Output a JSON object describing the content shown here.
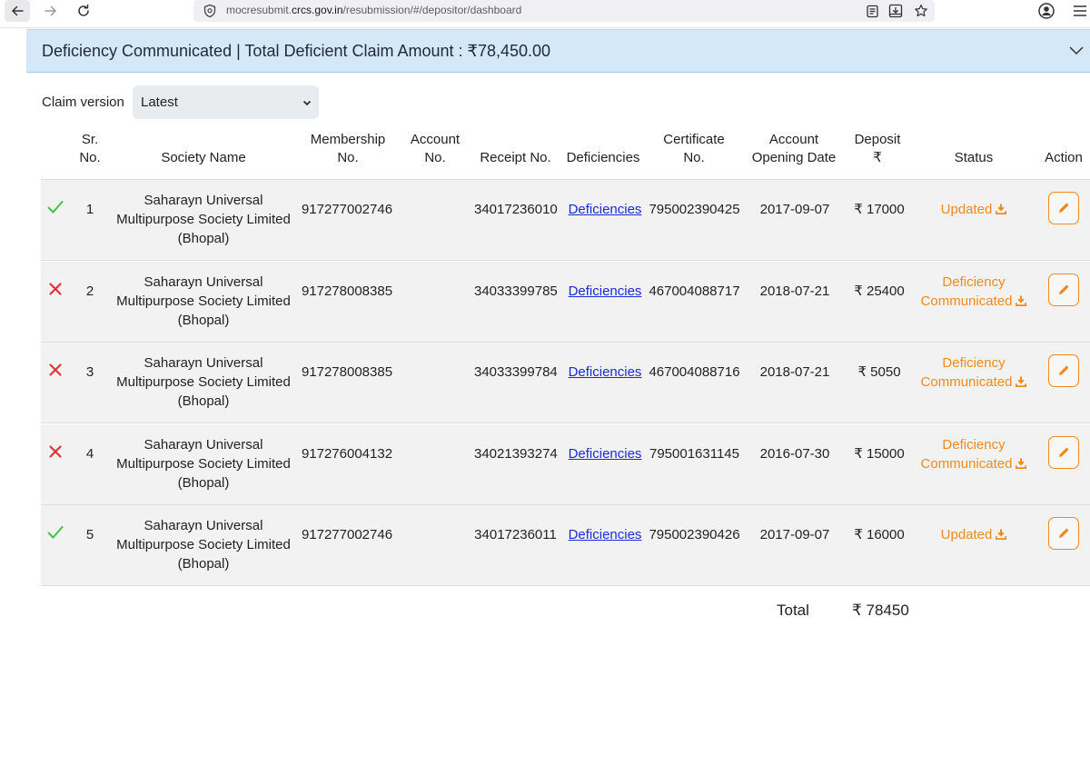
{
  "browser": {
    "url_prefix": "mocresubmit.",
    "url_domain": "crcs.gov.in",
    "url_path": "/resubmission/#/depositor/dashboard"
  },
  "accordion": {
    "title": "Deficiency Communicated | Total Deficient Claim Amount : ₹78,450.00"
  },
  "claim_version": {
    "label": "Claim version",
    "selected": "Latest"
  },
  "table": {
    "headers": {
      "sr_1": "Sr.",
      "sr_2": "No.",
      "society": "Society Name",
      "membership_1": "Membership",
      "membership_2": "No.",
      "account_1": "Account",
      "account_2": "No.",
      "receipt": "Receipt No.",
      "deficiencies": "Deficiencies",
      "certificate_1": "Certificate",
      "certificate_2": "No.",
      "opening_1": "Account",
      "opening_2": "Opening Date",
      "deposit_1": "Deposit",
      "deposit_2": "₹",
      "status": "Status",
      "action": "Action"
    },
    "rows": [
      {
        "mark": "check-icon",
        "sr": "1",
        "society_1": "Saharayn Universal",
        "society_2": "Multipurpose Society Limited",
        "society_3": "(Bhopal)",
        "membership": "917277002746",
        "account": "",
        "receipt": "34017236010",
        "deficiencies": "Deficiencies",
        "certificate": "795002390425",
        "opening_date": "2017-09-07",
        "deposit": "₹ 17000",
        "status_1": "Updated",
        "status_2": ""
      },
      {
        "mark": "cross-icon",
        "sr": "2",
        "society_1": "Saharayn Universal",
        "society_2": "Multipurpose Society Limited",
        "society_3": "(Bhopal)",
        "membership": "917278008385",
        "account": "",
        "receipt": "34033399785",
        "deficiencies": "Deficiencies",
        "certificate": "467004088717",
        "opening_date": "2018-07-21",
        "deposit": "₹ 25400",
        "status_1": "Deficiency",
        "status_2": "Communicated"
      },
      {
        "mark": "cross-icon",
        "sr": "3",
        "society_1": "Saharayn Universal",
        "society_2": "Multipurpose Society Limited",
        "society_3": "(Bhopal)",
        "membership": "917278008385",
        "account": "",
        "receipt": "34033399784",
        "deficiencies": "Deficiencies",
        "certificate": "467004088716",
        "opening_date": "2018-07-21",
        "deposit": "₹ 5050",
        "status_1": "Deficiency",
        "status_2": "Communicated"
      },
      {
        "mark": "cross-icon",
        "sr": "4",
        "society_1": "Saharayn Universal",
        "society_2": "Multipurpose Society Limited",
        "society_3": "(Bhopal)",
        "membership": "917276004132",
        "account": "",
        "receipt": "34021393274",
        "deficiencies": "Deficiencies",
        "certificate": "795001631145",
        "opening_date": "2016-07-30",
        "deposit": "₹ 15000",
        "status_1": "Deficiency",
        "status_2": "Communicated"
      },
      {
        "mark": "check-icon",
        "sr": "5",
        "society_1": "Saharayn Universal",
        "society_2": "Multipurpose Society Limited",
        "society_3": "(Bhopal)",
        "membership": "917277002746",
        "account": "",
        "receipt": "34017236011",
        "deficiencies": "Deficiencies",
        "certificate": "795002390426",
        "opening_date": "2017-09-07",
        "deposit": "₹ 16000",
        "status_1": "Updated",
        "status_2": ""
      }
    ],
    "total_label": "Total",
    "total_value": "₹ 78450"
  },
  "colors": {
    "accent_orange": "#f08a1c",
    "link_blue": "#1a2bd8",
    "check_green": "#3ec43e",
    "cross_red": "#e03434",
    "header_bg": "#d4e8f8"
  }
}
